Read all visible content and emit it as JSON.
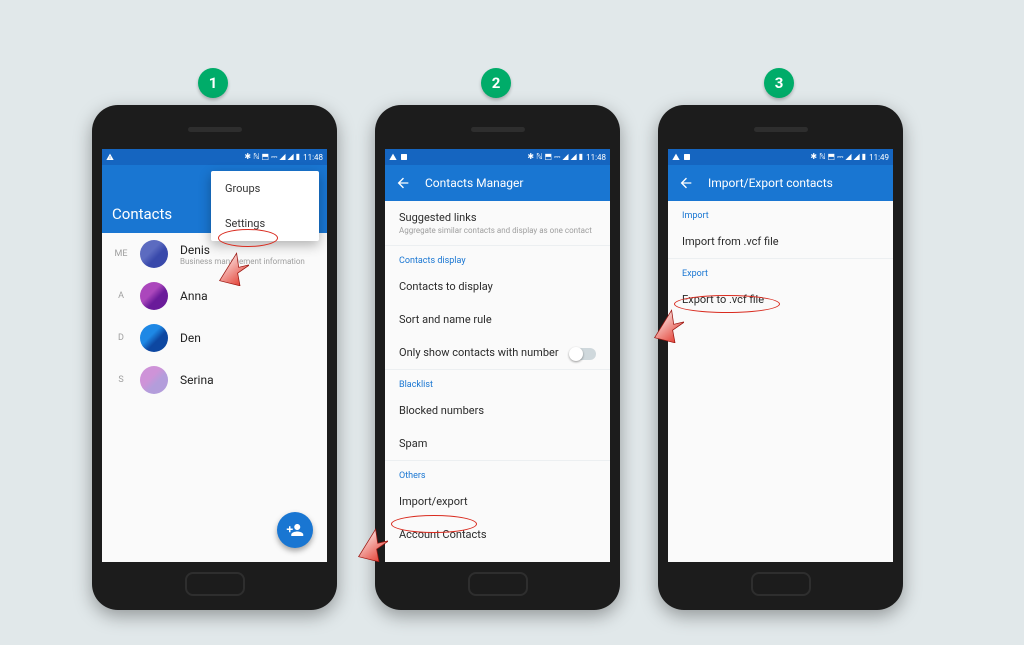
{
  "steps": [
    "1",
    "2",
    "3"
  ],
  "status": {
    "time1": "11:48",
    "time2": "11:48",
    "time3": "11:49",
    "icons_right": "✱ ℕ ⬒ ⎓ ◢ ◢ ▮"
  },
  "screen1": {
    "title": "Contacts",
    "menu": {
      "groups": "Groups",
      "settings": "Settings"
    },
    "me_tag": "ME",
    "contacts": [
      {
        "tag": "ME",
        "name": "Denis",
        "sub": "Business management information"
      },
      {
        "tag": "A",
        "name": "Anna",
        "sub": ""
      },
      {
        "tag": "D",
        "name": "Den",
        "sub": ""
      },
      {
        "tag": "S",
        "name": "Serina",
        "sub": ""
      }
    ]
  },
  "screen2": {
    "title": "Contacts Manager",
    "rows": {
      "suggested": "Suggested links",
      "suggested_sub": "Aggregate similar contacts and display as one contact",
      "section_display": "Contacts display",
      "contacts_to_display": "Contacts to display",
      "sort_rule": "Sort and name rule",
      "only_number": "Only show contacts with number",
      "section_blacklist": "Blacklist",
      "blocked": "Blocked numbers",
      "spam": "Spam",
      "section_others": "Others",
      "import_export": "Import/export",
      "account_contacts": "Account Contacts"
    }
  },
  "screen3": {
    "title": "Import/Export contacts",
    "section_import": "Import",
    "import_vcf": "Import from .vcf file",
    "section_export": "Export",
    "export_vcf": "Export to .vcf file"
  }
}
